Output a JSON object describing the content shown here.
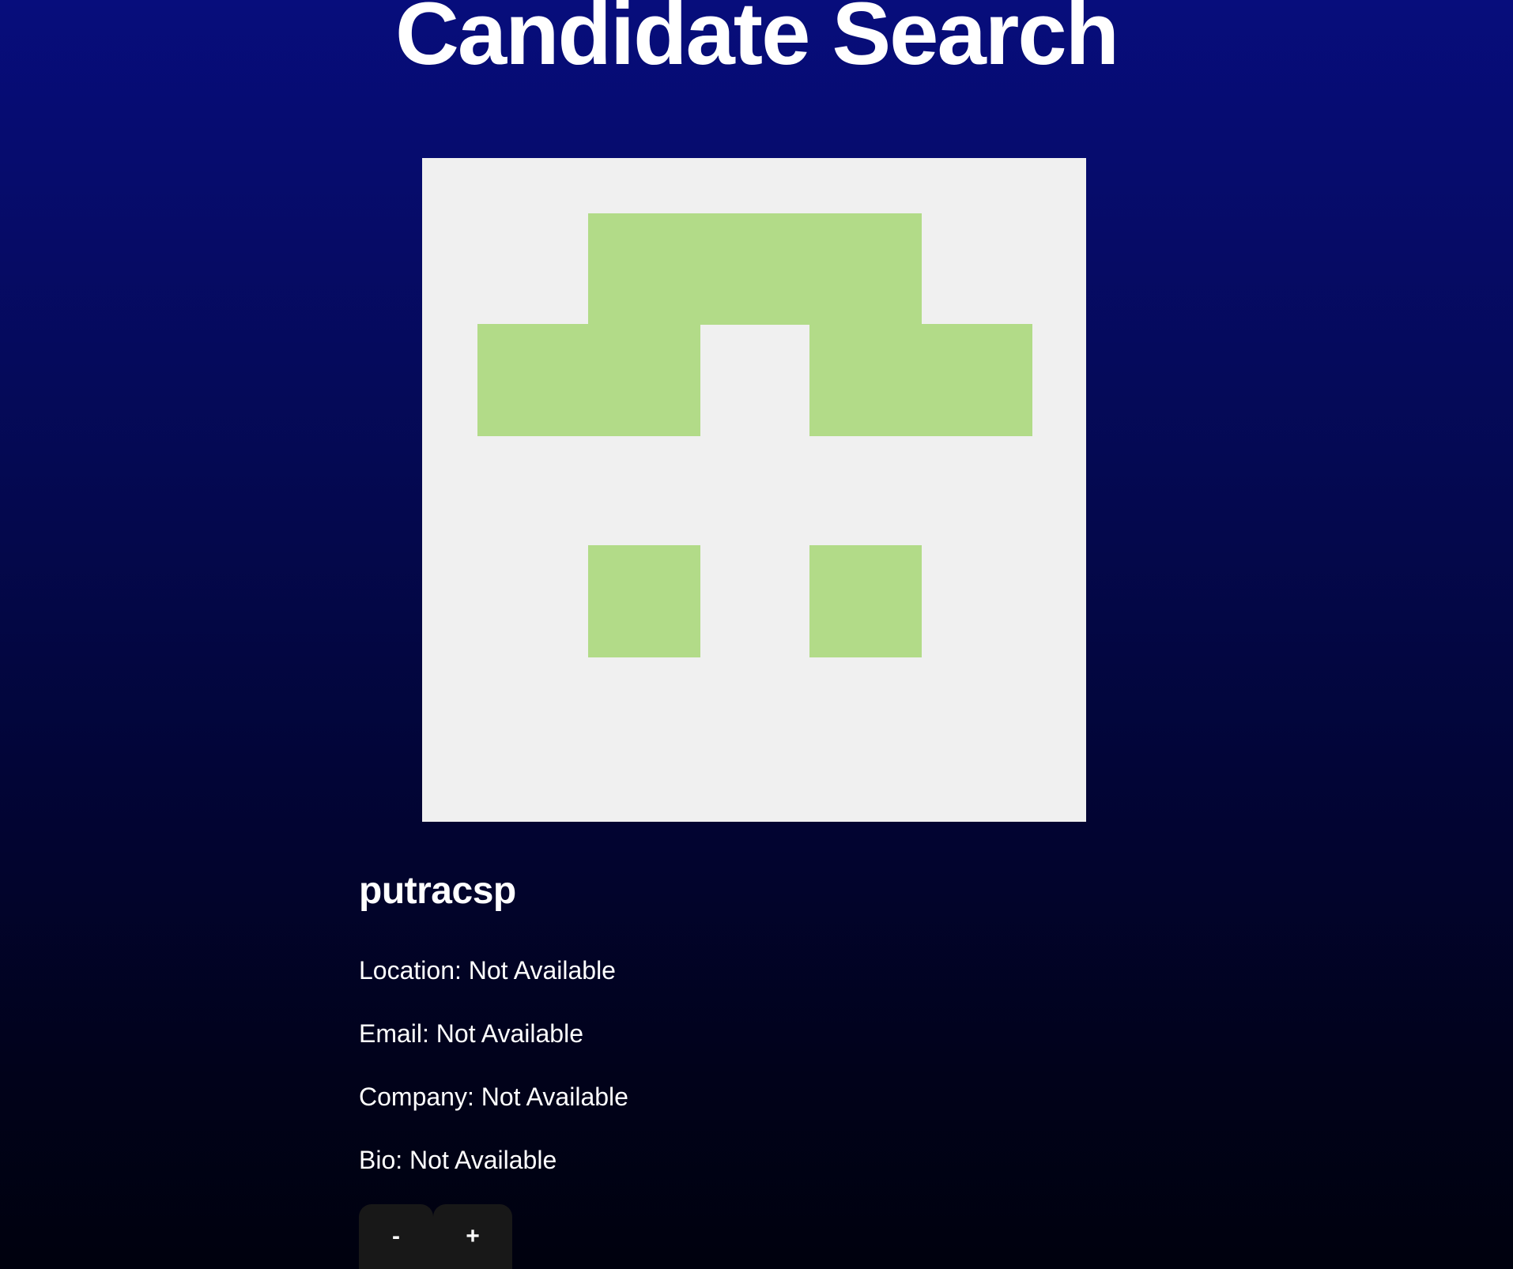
{
  "header": {
    "title": "Candidate Search"
  },
  "candidate": {
    "avatar": {
      "description": "identicon",
      "background_color": "#f0f0f0",
      "fill_color": "#b2db88"
    },
    "username": "putracsp",
    "location_line": "Location: Not Available",
    "email_line": "Email: Not Available",
    "company_line": "Company: Not Available",
    "bio_line": "Bio: Not Available"
  },
  "actions": {
    "reject_label": "-",
    "accept_label": "+"
  },
  "colors": {
    "background_top": "#070d7c",
    "background_bottom": "#00010e",
    "button_bg": "#181818",
    "text": "#ffffff"
  }
}
